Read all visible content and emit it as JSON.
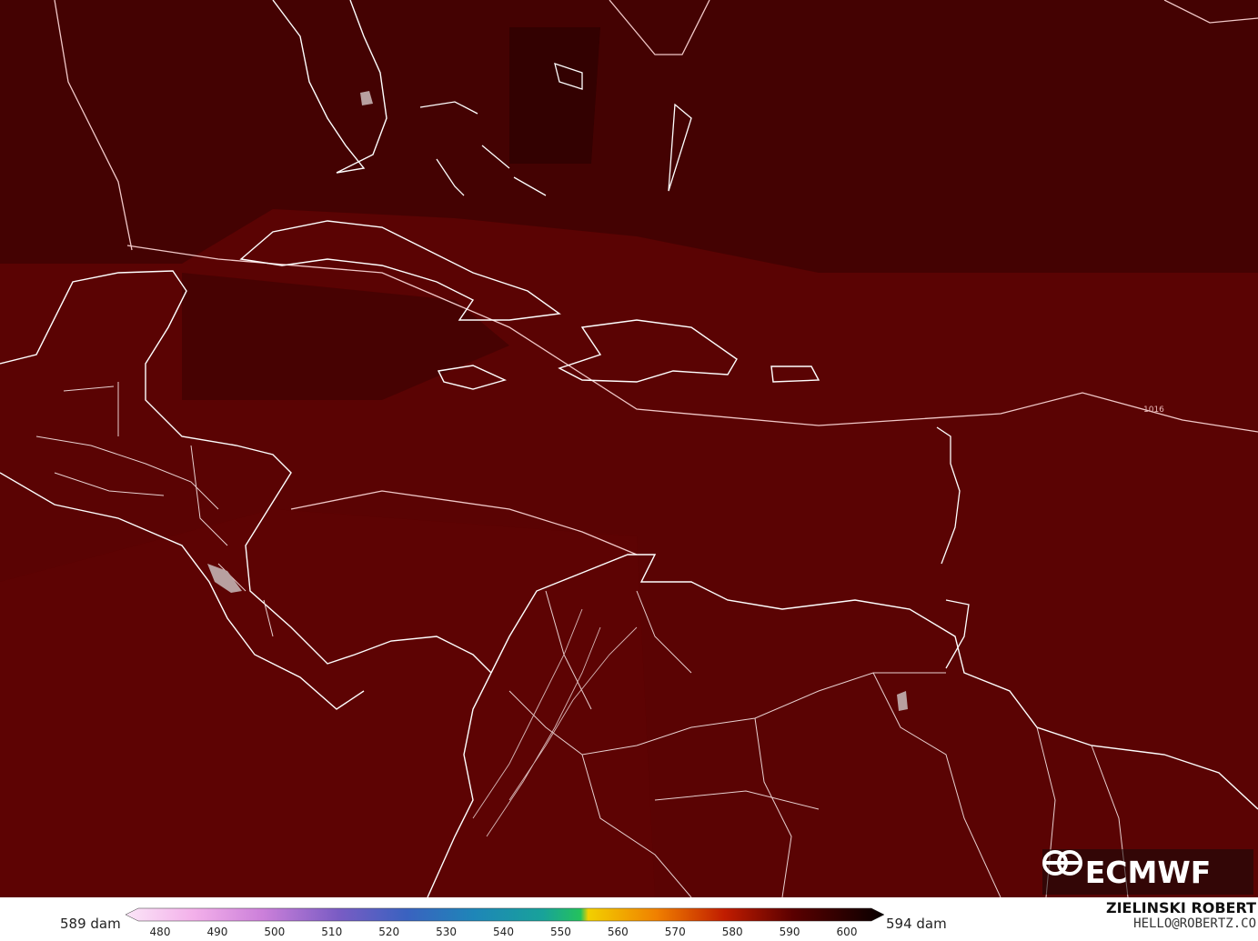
{
  "map": {
    "isobar_label": "1016",
    "fill_color": "#5a0303"
  },
  "logo": {
    "text": "ECMWF"
  },
  "legend": {
    "min_label": "589 dam",
    "max_label": "594 dam",
    "ticks": [
      "480",
      "490",
      "500",
      "510",
      "520",
      "530",
      "540",
      "550",
      "560",
      "570",
      "580",
      "590",
      "600"
    ],
    "colors": [
      "#f8d8f4",
      "#f0a8e8",
      "#c878d8",
      "#8060c8",
      "#4060c0",
      "#2080c0",
      "#18a0a0",
      "#20c060",
      "#f8d000",
      "#f08000",
      "#c02000",
      "#600000",
      "#100000"
    ]
  },
  "credit": {
    "name": "ZIELINSKI ROBERT",
    "email": "HELLO@ROBERTZ.CO"
  }
}
